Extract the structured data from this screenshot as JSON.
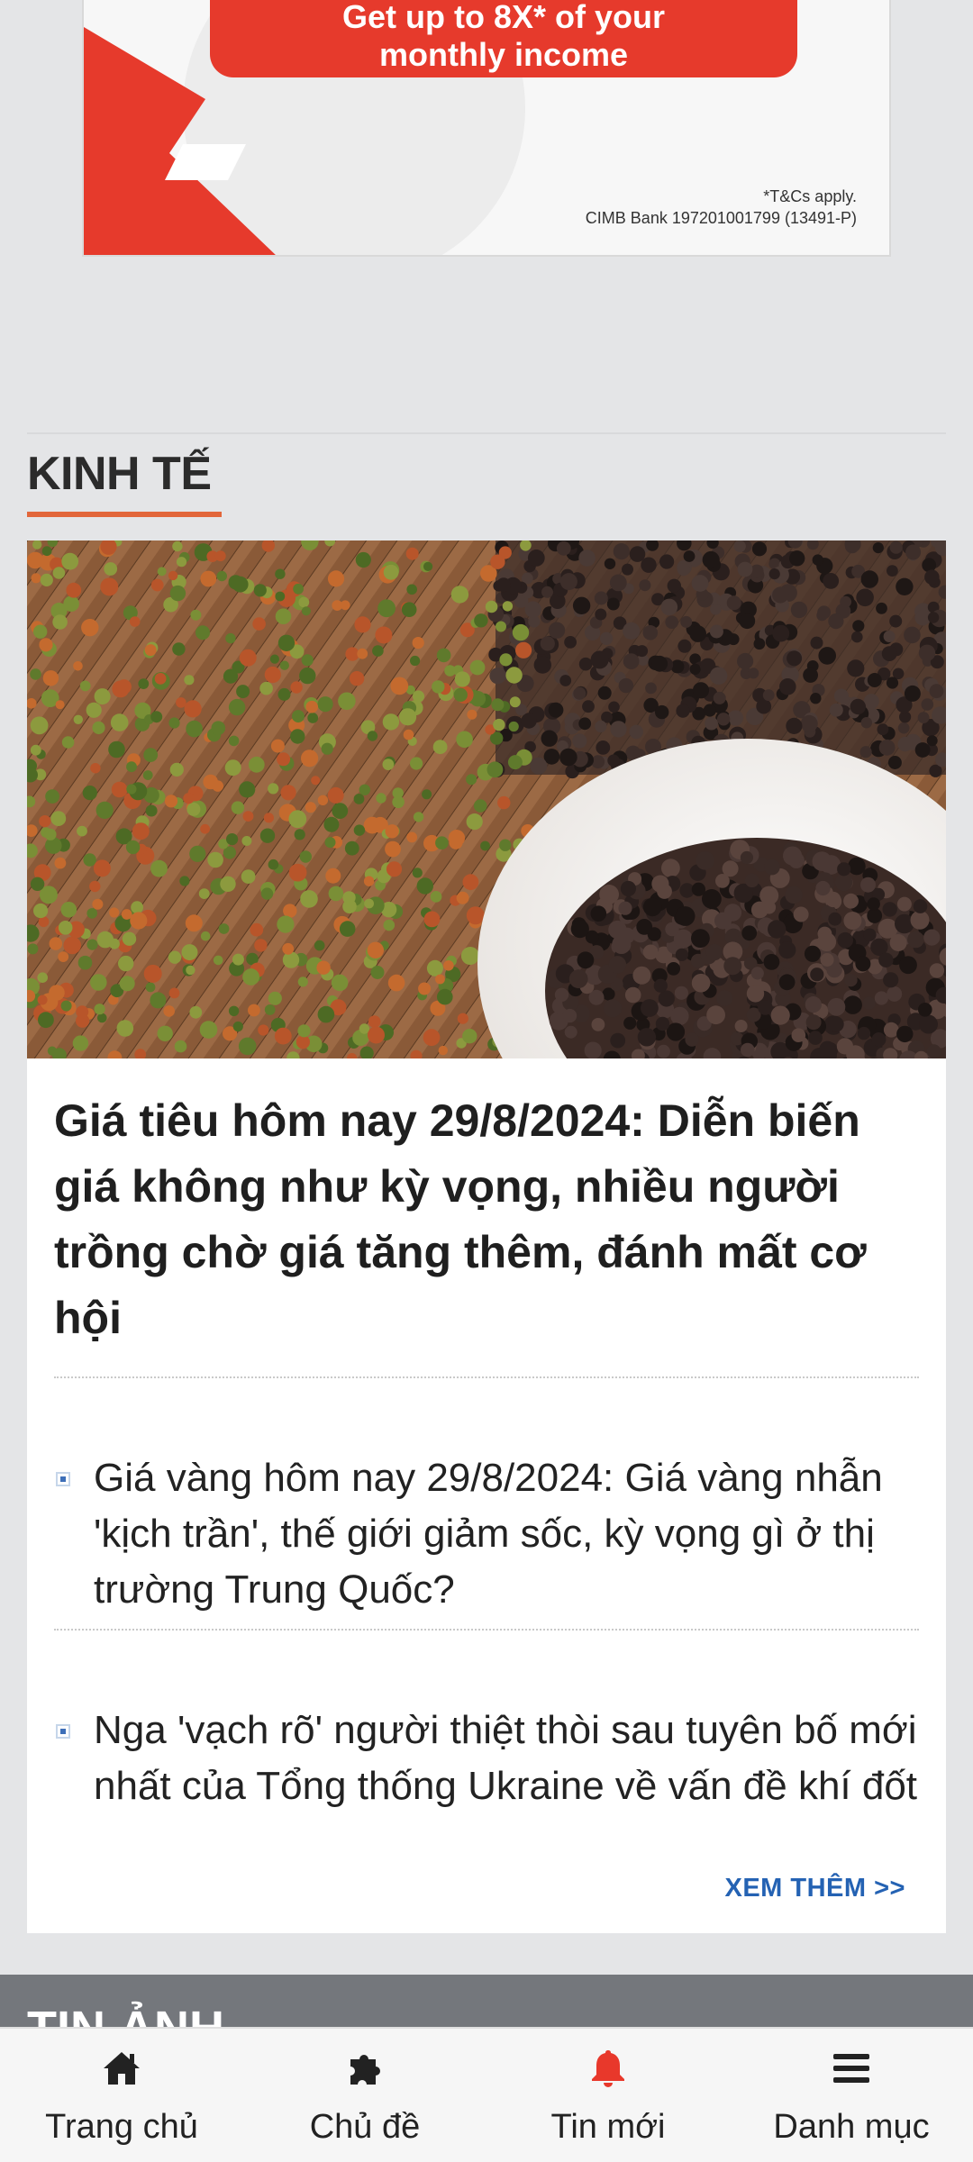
{
  "ad": {
    "cta_line1": "Get up to 8X* of your",
    "cta_line2": "monthly income",
    "fine_print1": "*T&Cs apply.",
    "fine_print2": "CIMB Bank 197201001799 (13491-P)",
    "brand_color": "#e63a2c"
  },
  "section": {
    "title": "KINH TẾ",
    "accent_color": "#e2663a"
  },
  "lead_article": {
    "image_alt": "Hạt tiêu xanh và tiêu đen phơi trên nong",
    "headline": "Giá tiêu hôm nay 29/8/2024: Diễn biến giá không như kỳ vọng, nhiều người trồng chờ giá tăng thêm, đánh mất cơ hội"
  },
  "related": [
    {
      "title": "Giá vàng hôm nay 29/8/2024: Giá vàng nhẫn 'kịch trần', thế giới giảm sốc, kỳ vọng gì ở thị trường Trung Quốc?"
    },
    {
      "title": "Nga 'vạch rõ' người thiệt thòi sau tuyên bố mới nhất của Tổng thống Ukraine về vấn đề khí đốt"
    }
  ],
  "more_link": "XEM THÊM >>",
  "next_section": {
    "title": "TIN ẢNH"
  },
  "bottom_nav": [
    {
      "label": "Trang chủ",
      "icon": "home-icon",
      "color": "#222222"
    },
    {
      "label": "Chủ đề",
      "icon": "puzzle-icon",
      "color": "#222222"
    },
    {
      "label": "Tin mới",
      "icon": "bell-icon",
      "color": "#e8382b"
    },
    {
      "label": "Danh mục",
      "icon": "menu-icon",
      "color": "#222222"
    }
  ]
}
